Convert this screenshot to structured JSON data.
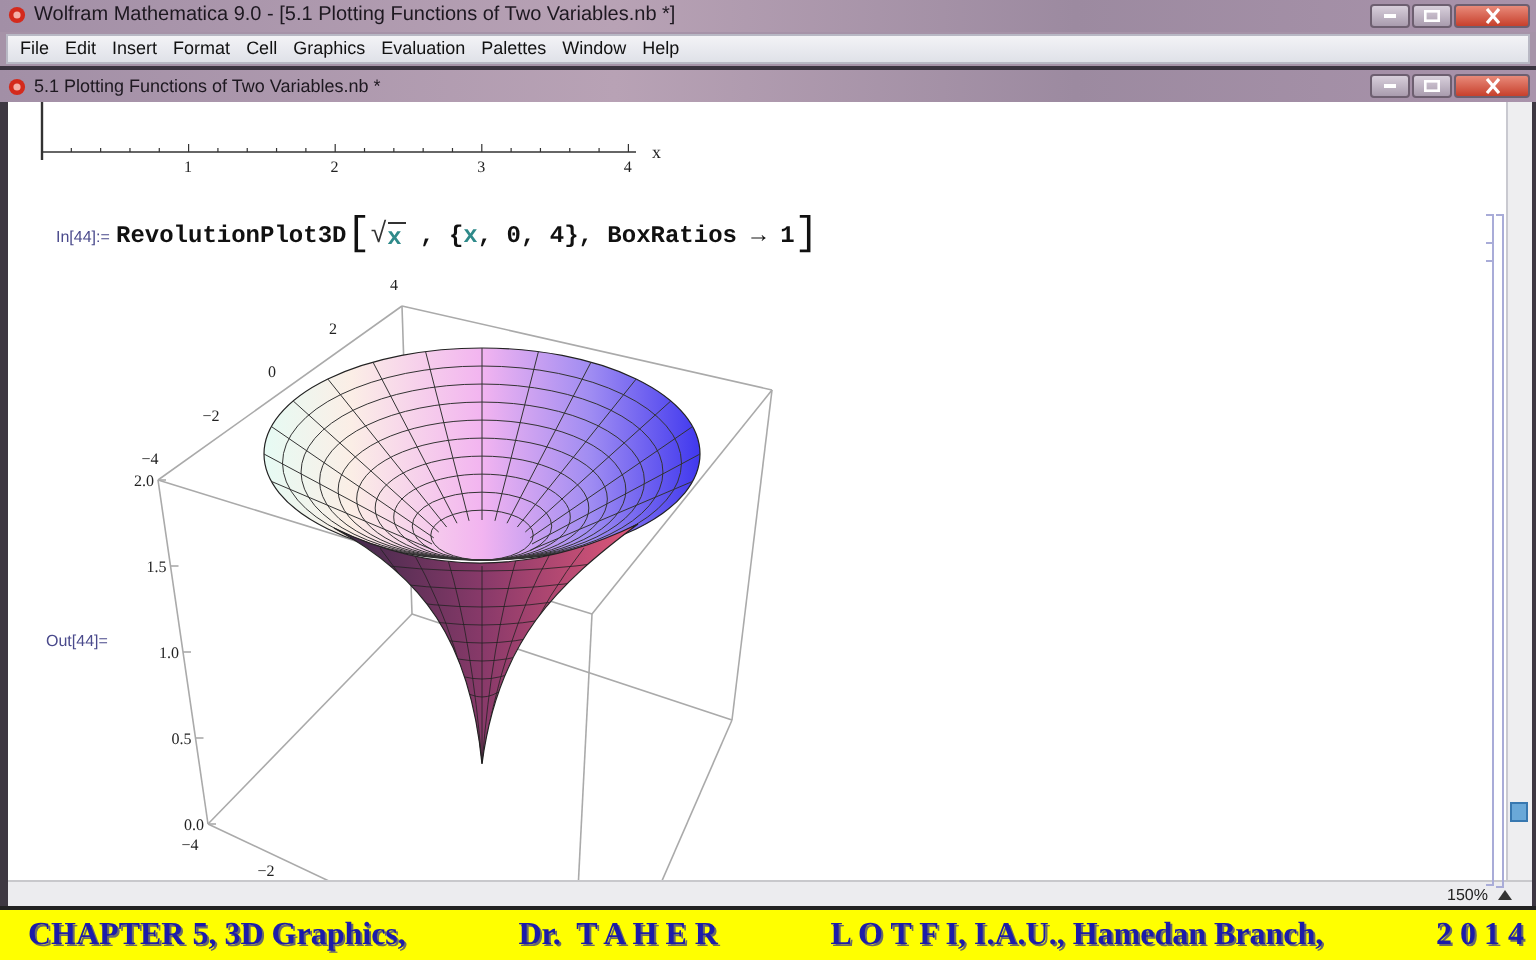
{
  "window": {
    "title": "Wolfram Mathematica 9.0 - [5.1 Plotting Functions of Two Variables.nb *]"
  },
  "menu": [
    "File",
    "Edit",
    "Insert",
    "Format",
    "Cell",
    "Graphics",
    "Evaluation",
    "Palettes",
    "Window",
    "Help"
  ],
  "notebook": {
    "title": "5.1 Plotting Functions of Two Variables.nb *",
    "previous_plot": {
      "x_ticks": [
        "1",
        "2",
        "3",
        "4"
      ],
      "x_label": "x"
    },
    "input_cell": {
      "label": "In[44]:=",
      "code": [
        {
          "kind": "plain",
          "text": "RevolutionPlot3D"
        },
        {
          "kind": "bracket",
          "text": "["
        },
        {
          "kind": "radical",
          "text": "√"
        },
        {
          "kind": "sqrt",
          "text": "x"
        },
        {
          "kind": "plain",
          "text": " , {"
        },
        {
          "kind": "var",
          "text": "x"
        },
        {
          "kind": "plain",
          "text": ", 0, 4}, BoxRatios → 1"
        },
        {
          "kind": "bracket",
          "text": "]"
        }
      ]
    },
    "output_cell": {
      "label": "Out[44]=",
      "plot": {
        "vertical_ticks": [
          "2.0",
          "1.5",
          "1.0",
          "0.5",
          "0.0"
        ],
        "back_ticks": [
          "4",
          "2",
          "0",
          "−2",
          "−4"
        ],
        "front_ticks": [
          "−4",
          "−2"
        ]
      }
    },
    "zoom": "150%"
  },
  "banner": [
    "CHAPTER 5, 3D Graphics,",
    "Dr.  T A H E R",
    "L O T F I, I.A.U., Hamedan Branch,",
    "2 0 1 4"
  ]
}
